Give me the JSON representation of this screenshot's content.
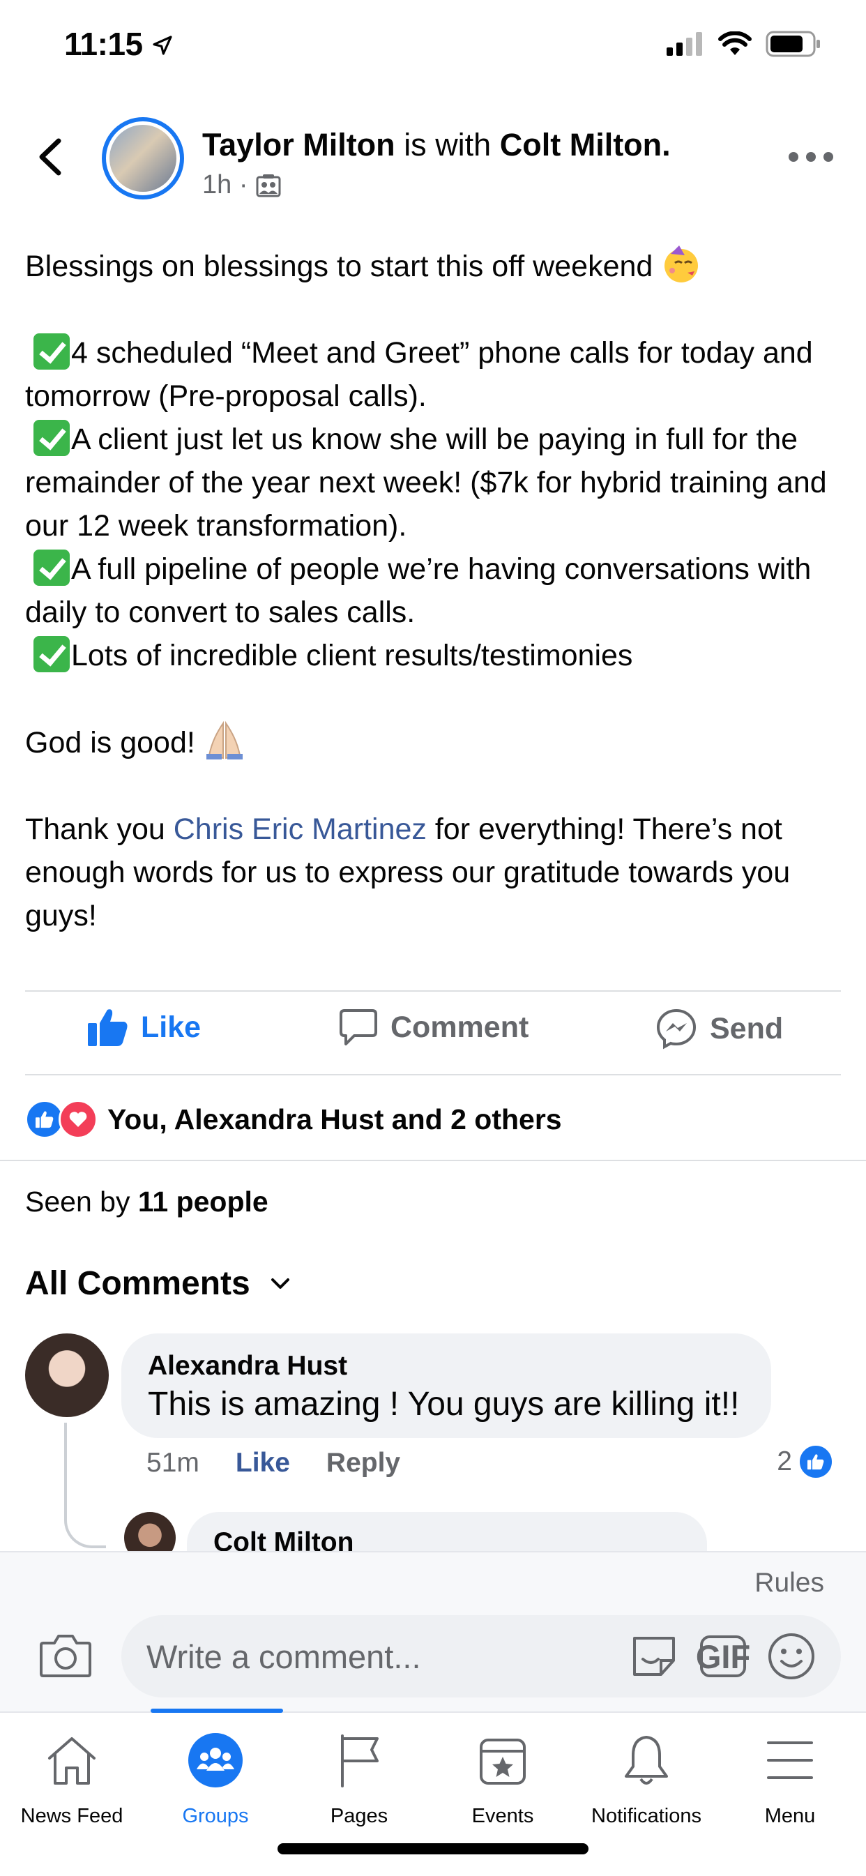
{
  "status_bar": {
    "time": "11:15"
  },
  "post": {
    "author": "Taylor Milton",
    "with_text": "is with",
    "tagged": "Colt Milton.",
    "time": "1h ·",
    "intro": "Blessings on blessings to start this off weekend",
    "items": [
      "4 scheduled “Meet and Greet” phone calls for today and tomorrow (Pre-proposal calls).",
      "A client just let us know she will be paying in full for the remainder of the year next week! ($7k for hybrid training and our 12 week transformation).",
      "A full pipeline of people we’re having conversations with daily to convert to sales calls.",
      "Lots of incredible client results/testimonies"
    ],
    "god_line": "God is good!",
    "thanks_prefix": "Thank you ",
    "thanks_link": "Chris Eric Martinez",
    "thanks_suffix": " for everything! There’s not enough words for us to express our gratitude towards you guys!"
  },
  "actions": {
    "like": "Like",
    "comment": "Comment",
    "send": "Send"
  },
  "reactions_text": "You, Alexandra Hust and 2 others",
  "seen": {
    "prefix": "Seen by ",
    "count": "11 people"
  },
  "comments_header": "All Comments",
  "comments": [
    {
      "name": "Alexandra Hust",
      "text": "This is amazing ! You guys are killing it!!",
      "time": "51m",
      "like": "Like",
      "reply": "Reply",
      "reactions": "2"
    }
  ],
  "reply_preview": {
    "name": "Colt Milton"
  },
  "composer": {
    "rules": "Rules",
    "placeholder": "Write a comment...",
    "gif": "GIF"
  },
  "tabs": [
    {
      "label": "News Feed"
    },
    {
      "label": "Groups"
    },
    {
      "label": "Pages"
    },
    {
      "label": "Events"
    },
    {
      "label": "Notifications"
    },
    {
      "label": "Menu"
    }
  ],
  "colors": {
    "accent": "#1877f2",
    "link": "#385898",
    "check": "#3bb54a"
  }
}
